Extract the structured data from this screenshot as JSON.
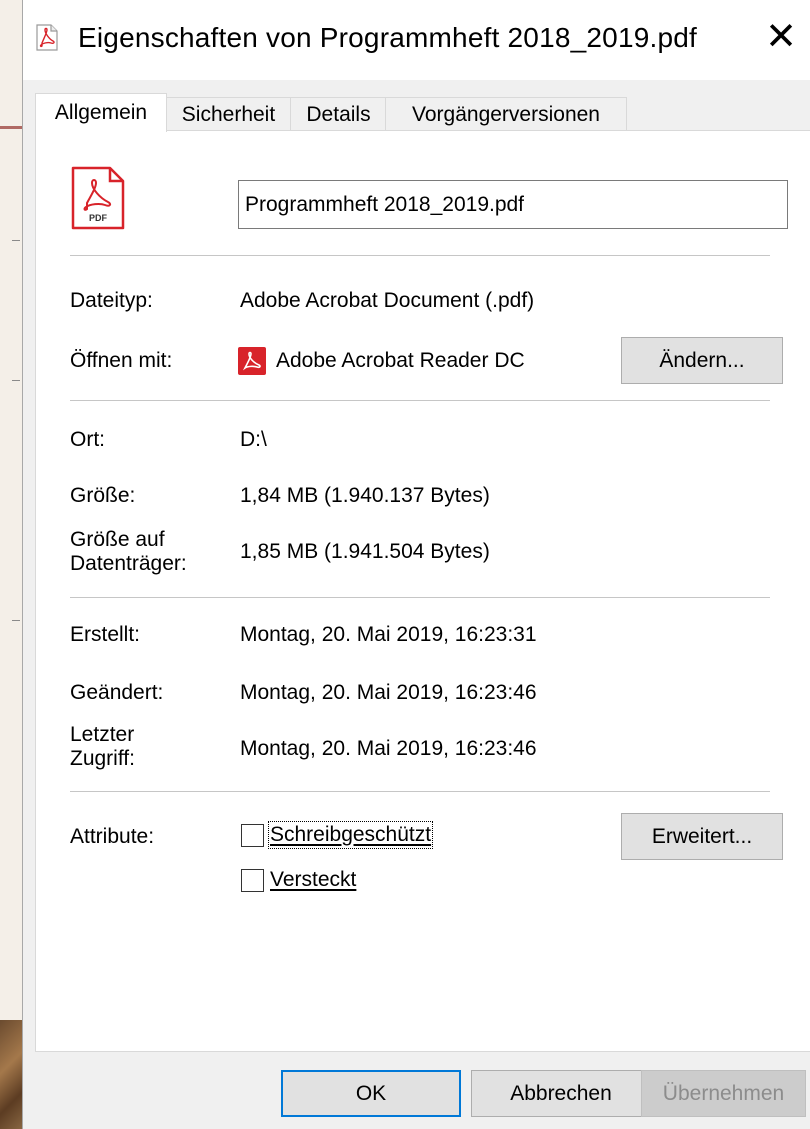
{
  "window": {
    "title": "Eigenschaften von Programmheft 2018_2019.pdf",
    "close_glyph": "✕"
  },
  "tabs": [
    {
      "label": "Allgemein",
      "active": true
    },
    {
      "label": "Sicherheit",
      "active": false
    },
    {
      "label": "Details",
      "active": false
    },
    {
      "label": "Vorgängerversionen",
      "active": false
    }
  ],
  "file": {
    "icon": "pdf-file-icon",
    "icon_caption": "PDF",
    "name": "Programmheft 2018_2019.pdf"
  },
  "info": {
    "type_label": "Dateityp:",
    "type_value": "Adobe Acrobat Document (.pdf)",
    "open_with_label": "Öffnen mit:",
    "open_with_value": "Adobe Acrobat Reader DC",
    "change_button": "Ändern...",
    "location_label": "Ort:",
    "location_value": "D:\\",
    "size_label": "Größe:",
    "size_value": "1,84 MB (1.940.137 Bytes)",
    "size_on_disk_label_1": "Größe auf",
    "size_on_disk_label_2": "Datenträger:",
    "size_on_disk_value": "1,85 MB (1.941.504 Bytes)",
    "created_label": "Erstellt:",
    "created_value": "Montag, 20. Mai 2019, 16:23:31",
    "modified_label": "Geändert:",
    "modified_value": "Montag, 20. Mai 2019, 16:23:46",
    "accessed_label_1": "Letzter",
    "accessed_label_2": "Zugriff:",
    "accessed_value": "Montag, 20. Mai 2019, 16:23:46"
  },
  "attributes": {
    "label": "Attribute:",
    "readonly_label": "Schreibgeschützt",
    "readonly_checked": false,
    "hidden_label": "Versteckt",
    "hidden_checked": false,
    "advanced_button": "Erweitert..."
  },
  "footer": {
    "ok": "OK",
    "cancel": "Abbrechen",
    "apply": "Übernehmen",
    "apply_enabled": false
  },
  "colors": {
    "acrobat_red": "#d8232a",
    "ok_border": "#0078d7",
    "disabled_text": "#8c8c8c"
  }
}
